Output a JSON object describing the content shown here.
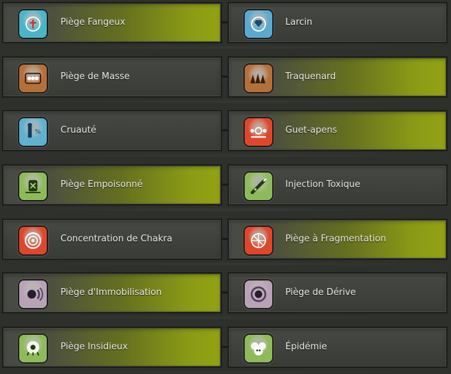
{
  "spells": [
    {
      "left": {
        "label": "Piège Fangeux",
        "icon": "mud-trap-icon",
        "color": "#4bb4c9",
        "active": true
      },
      "right": {
        "label": "Larcin",
        "icon": "larceny-icon",
        "color": "#5aa9cf",
        "active": false
      }
    },
    {
      "left": {
        "label": "Piège de Masse",
        "icon": "mass-trap-icon",
        "color": "#b5703a",
        "active": false
      },
      "right": {
        "label": "Traquenard",
        "icon": "ambush-trap-icon",
        "color": "#b5703a",
        "active": true
      }
    },
    {
      "left": {
        "label": "Cruauté",
        "icon": "cruelty-icon",
        "color": "#5fb1cf",
        "active": false
      },
      "right": {
        "label": "Guet-apens",
        "icon": "ambush-icon",
        "color": "#e0462a",
        "active": true
      }
    },
    {
      "left": {
        "label": "Piège Empoisonné",
        "icon": "poison-trap-icon",
        "color": "#8fba5a",
        "active": true
      },
      "right": {
        "label": "Injection Toxique",
        "icon": "toxic-injection-icon",
        "color": "#8fba5a",
        "active": false
      }
    },
    {
      "left": {
        "label": "Concentration de Chakra",
        "icon": "chakra-icon",
        "color": "#e0462a",
        "active": false
      },
      "right": {
        "label": "Piège à Fragmentation",
        "icon": "fragmentation-trap-icon",
        "color": "#e0462a",
        "active": true
      }
    },
    {
      "left": {
        "label": "Piège d'Immobilisation",
        "icon": "immobilization-trap-icon",
        "color": "#b8a2b6",
        "active": true
      },
      "right": {
        "label": "Piège de Dérive",
        "icon": "drift-trap-icon",
        "color": "#b8a2b6",
        "active": false
      }
    },
    {
      "left": {
        "label": "Piège Insidieux",
        "icon": "insidious-trap-icon",
        "color": "#8fba5a",
        "active": true
      },
      "right": {
        "label": "Épidémie",
        "icon": "epidemic-icon",
        "color": "#8fba5a",
        "active": false
      }
    }
  ],
  "colors": {
    "active_gradient_end": "#93a312",
    "card_base": "#474944",
    "background": "#2e302c"
  }
}
